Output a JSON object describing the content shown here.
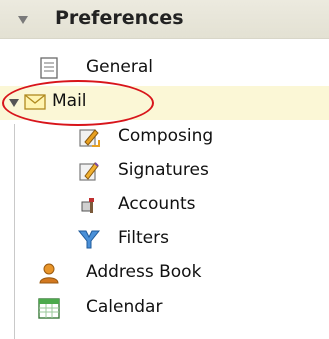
{
  "panel": {
    "title": "Preferences",
    "items": [
      {
        "label": "General",
        "icon": "document-icon"
      },
      {
        "label": "Mail",
        "icon": "envelope-icon"
      },
      {
        "label": "Composing",
        "icon": "composing-icon"
      },
      {
        "label": "Signatures",
        "icon": "signatures-icon"
      },
      {
        "label": "Accounts",
        "icon": "accounts-icon"
      },
      {
        "label": "Filters",
        "icon": "filters-icon"
      },
      {
        "label": "Address Book",
        "icon": "address-book-icon"
      },
      {
        "label": "Calendar",
        "icon": "calendar-icon"
      }
    ]
  },
  "colors": {
    "selected_row": "#fbf7d6",
    "highlight_ellipse": "#d8151b"
  }
}
